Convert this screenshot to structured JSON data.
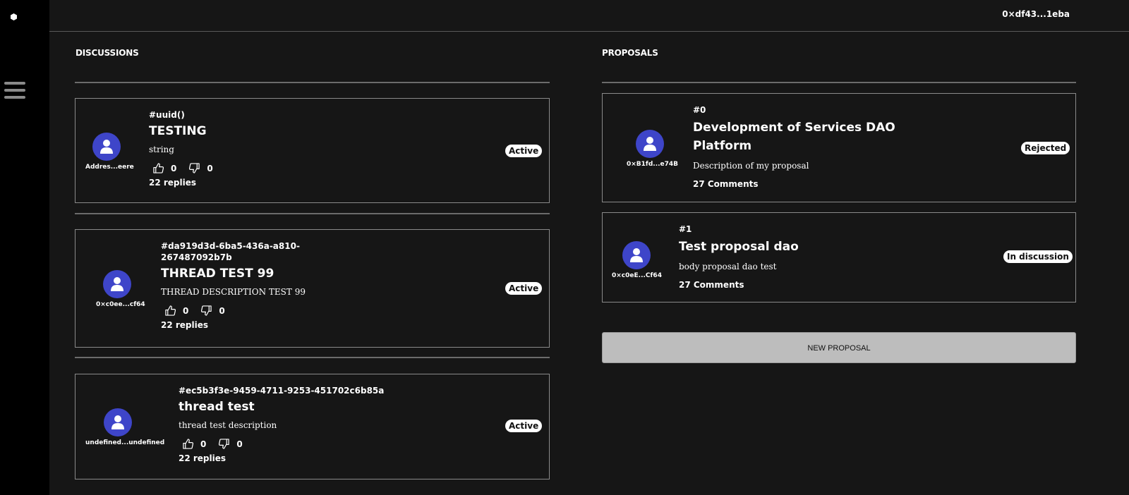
{
  "header": {
    "wallet_address": "0×df43...1eba"
  },
  "sidebar": {
    "logo_icon": "hexagon-logo-icon",
    "menu_icon": "hamburger-menu-icon"
  },
  "discussions": {
    "title": "DISCUSSIONS",
    "items": [
      {
        "id": "#uuid()",
        "title": "TESTING",
        "description": "string",
        "author": "Addres...eere",
        "status": "Active",
        "upvotes": "0",
        "downvotes": "0",
        "replies": "22 replies"
      },
      {
        "id": "#da919d3d-6ba5-436a-a810-267487092b7b",
        "title": "THREAD TEST 99",
        "description": "THREAD DESCRIPTION TEST 99",
        "author": "0×c0ee...cf64",
        "status": "Active",
        "upvotes": "0",
        "downvotes": "0",
        "replies": "22 replies"
      },
      {
        "id": "#ec5b3f3e-9459-4711-9253-451702c6b85a",
        "title": "thread test",
        "description": "thread test description",
        "author": "undefined...undefined",
        "status": "Active",
        "upvotes": "0",
        "downvotes": "0",
        "replies": "22 replies"
      }
    ]
  },
  "proposals": {
    "title": "PROPOSALS",
    "items": [
      {
        "id": "#0",
        "title": "Development of Services DAO Platform",
        "description": "Description of my proposal",
        "author": "0×B1fd...e74B",
        "status": "Rejected",
        "comments": "27 Comments"
      },
      {
        "id": "#1",
        "title": "Test proposal dao",
        "description": "body proposal dao test",
        "author": "0×c0eE...Cf64",
        "status": "In discussion",
        "comments": "27 Comments"
      }
    ],
    "new_button_label": "NEW PROPOSAL"
  },
  "colors": {
    "avatar": "#3e45c9",
    "background": "#161616",
    "sidebar": "#000000",
    "button": "#bdbdbd"
  }
}
